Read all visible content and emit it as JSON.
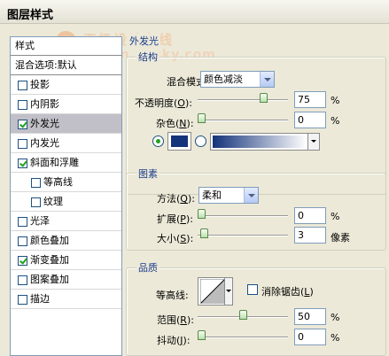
{
  "window": {
    "title": "图层样式"
  },
  "watermark": {
    "line1": "天极设计在线",
    "line2": "design.yesky.com"
  },
  "style_list": {
    "header": "样式",
    "blend_defaults": "混合选项:默认",
    "items": [
      {
        "label": "投影",
        "checked": false,
        "selected": false
      },
      {
        "label": "内阴影",
        "checked": false,
        "selected": false
      },
      {
        "label": "外发光",
        "checked": true,
        "selected": true
      },
      {
        "label": "内发光",
        "checked": false,
        "selected": false
      },
      {
        "label": "斜面和浮雕",
        "checked": true,
        "selected": false
      },
      {
        "label": "等高线",
        "checked": false,
        "selected": false,
        "indent": true
      },
      {
        "label": "纹理",
        "checked": false,
        "selected": false,
        "indent": true
      },
      {
        "label": "光泽",
        "checked": false,
        "selected": false
      },
      {
        "label": "颜色叠加",
        "checked": false,
        "selected": false
      },
      {
        "label": "渐变叠加",
        "checked": true,
        "selected": false
      },
      {
        "label": "图案叠加",
        "checked": false,
        "selected": false
      },
      {
        "label": "描边",
        "checked": false,
        "selected": false
      }
    ]
  },
  "panel": {
    "title": "外发光",
    "structure": {
      "title": "结构",
      "blend_mode_label": "混合模式:",
      "blend_mode_value": "颜色减淡",
      "opacity_label_pre": "不透明度(",
      "opacity_key": "O",
      "opacity_label_post": "):",
      "opacity_value": "75",
      "opacity_level": 75,
      "noise_label_pre": "杂色(",
      "noise_key": "N",
      "noise_label_post": "):",
      "noise_value": "0",
      "noise_level": 0,
      "percent": "%",
      "color_mode": "solid",
      "solid_color": "#14337a",
      "gradient_from": "#14337a",
      "gradient_to": "#ffffff"
    },
    "elements": {
      "title": "图素",
      "method_label_pre": "方法(",
      "method_key": "Q",
      "method_label_post": "):",
      "method_value": "柔和",
      "spread_label_pre": "扩展(",
      "spread_key": "P",
      "spread_label_post": "):",
      "spread_value": "0",
      "spread_level": 0,
      "size_label_pre": "大小(",
      "size_key": "S",
      "size_label_post": "):",
      "size_value": "3",
      "size_level": 3,
      "percent": "%",
      "pixels": "像素"
    },
    "quality": {
      "title": "品质",
      "contour_label": "等高线:",
      "antialias_label_pre": "消除锯齿(",
      "antialias_key": "L",
      "antialias_label_post": ")",
      "antialias_checked": false,
      "range_label_pre": "范围(",
      "range_key": "R",
      "range_label_post": "):",
      "range_value": "50",
      "range_level": 50,
      "jitter_label_pre": "抖动(",
      "jitter_key": "J",
      "jitter_label_post": "):",
      "jitter_value": "0",
      "jitter_level": 0,
      "percent": "%"
    }
  }
}
